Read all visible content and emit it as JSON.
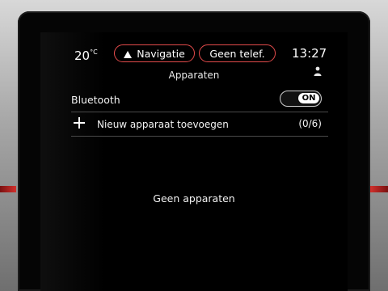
{
  "status_bar": {
    "temperature": "20",
    "temperature_unit": "°C",
    "navigation_label": "Navigatie",
    "phone_label": "Geen telef.",
    "time": "13:27"
  },
  "page": {
    "title": "Apparaten"
  },
  "bluetooth": {
    "label": "Bluetooth",
    "toggle_state": "ON"
  },
  "add_device": {
    "label": "Nieuw apparaat toevoegen",
    "count": "(0/6)"
  },
  "devices": {
    "empty_message": "Geen apparaten"
  },
  "colors": {
    "accent": "#e44b4b",
    "background": "#000000",
    "text": "#f2f2f2"
  }
}
